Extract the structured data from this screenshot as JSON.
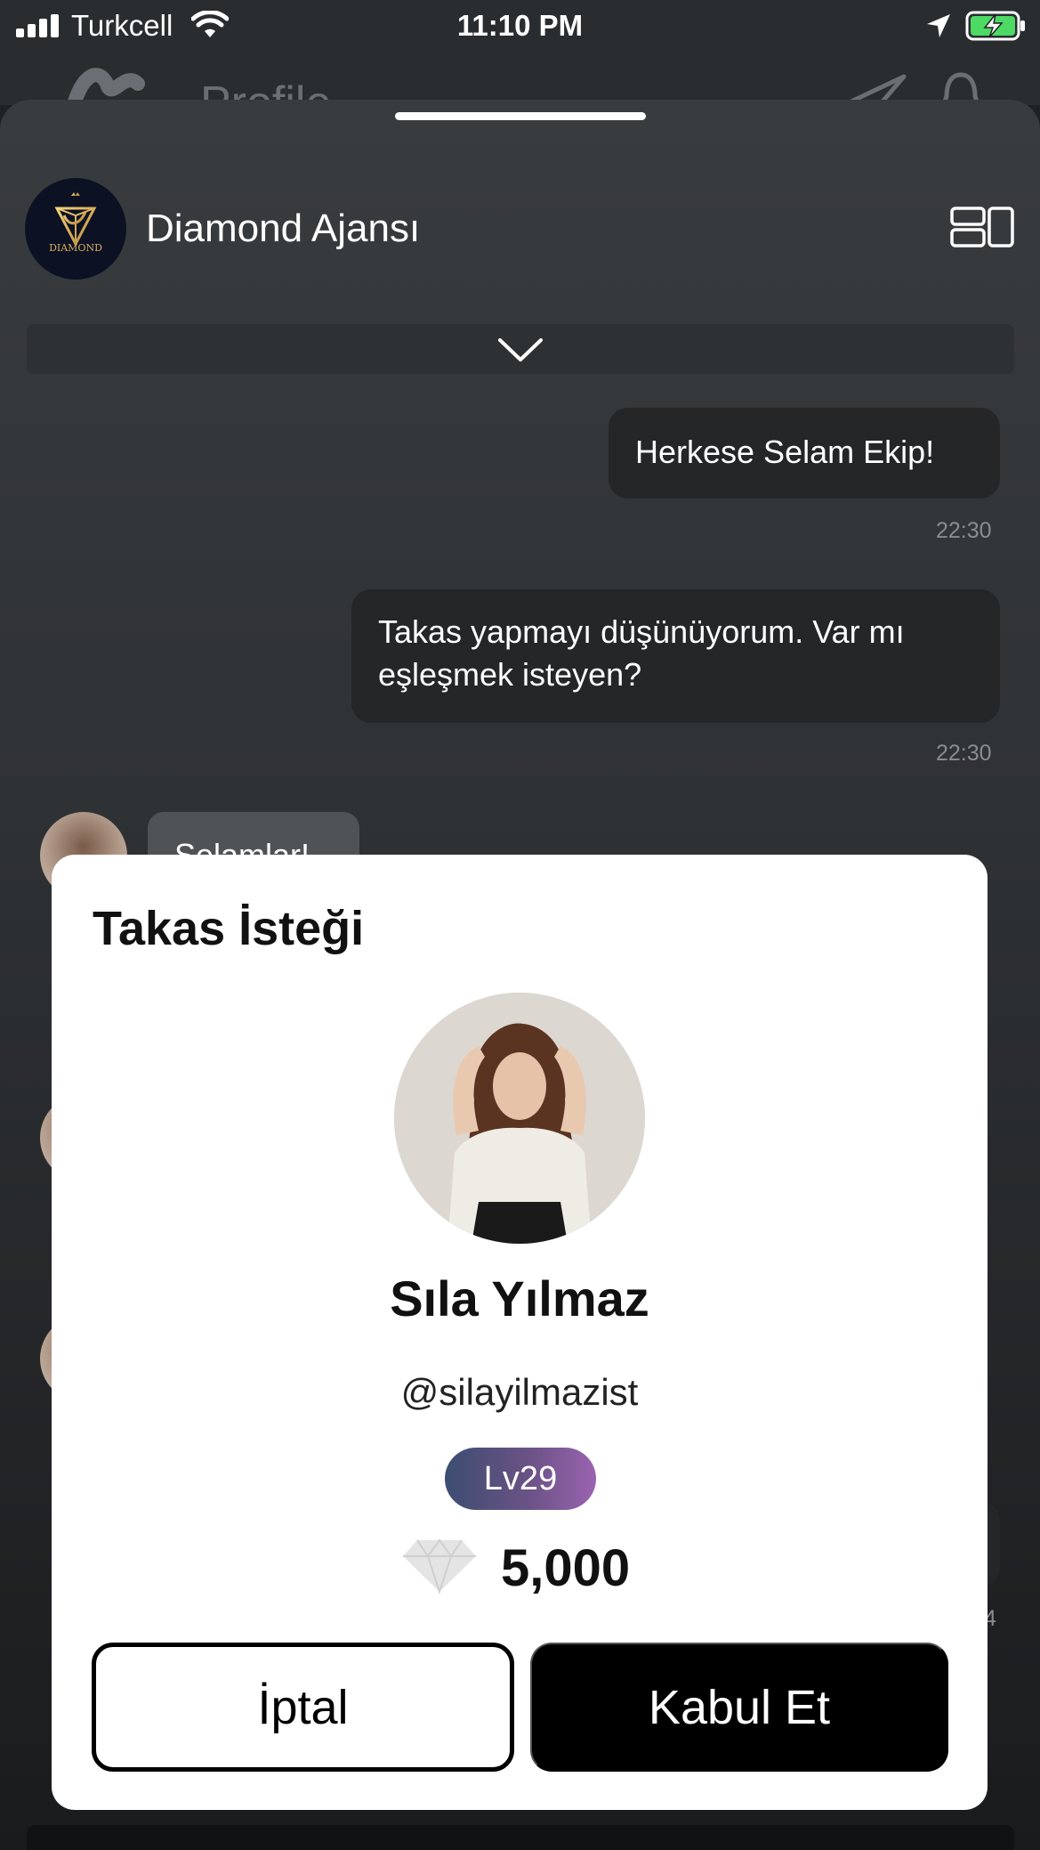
{
  "status_bar": {
    "carrier": "Turkcell",
    "time": "11:10 PM"
  },
  "background_header": {
    "title": "Profile"
  },
  "chat": {
    "group_name": "Diamond Ajansı",
    "group_avatar_text": "DIAMOND",
    "messages": [
      {
        "text": "Herkese Selam Ekip!",
        "time": "22:30",
        "direction": "outgoing"
      },
      {
        "text": "Takas yapmayı düşünüyorum. Var mı eşleşmek isteyen?",
        "time": "22:30",
        "direction": "outgoing"
      },
      {
        "text": "Selamlar!",
        "direction": "incoming"
      }
    ],
    "partial_time": "4"
  },
  "modal": {
    "title": "Takas İsteği",
    "user_name": "Sıla Yılmaz",
    "handle": "@silayilmazist",
    "level": "Lv29",
    "diamonds": "5,000",
    "cancel_label": "İptal",
    "accept_label": "Kabul Et"
  },
  "colors": {
    "accent_dark": "#000000",
    "level_gradient_start": "#3c4d72",
    "level_gradient_end": "#9a63b0",
    "battery_charging": "#4cd964"
  },
  "icons": [
    "signal-icon",
    "wifi-icon",
    "location-arrow-icon",
    "battery-charging-icon",
    "layout-toggle-icon",
    "chevron-down-icon",
    "diamond-icon",
    "send-icon",
    "bell-icon"
  ]
}
